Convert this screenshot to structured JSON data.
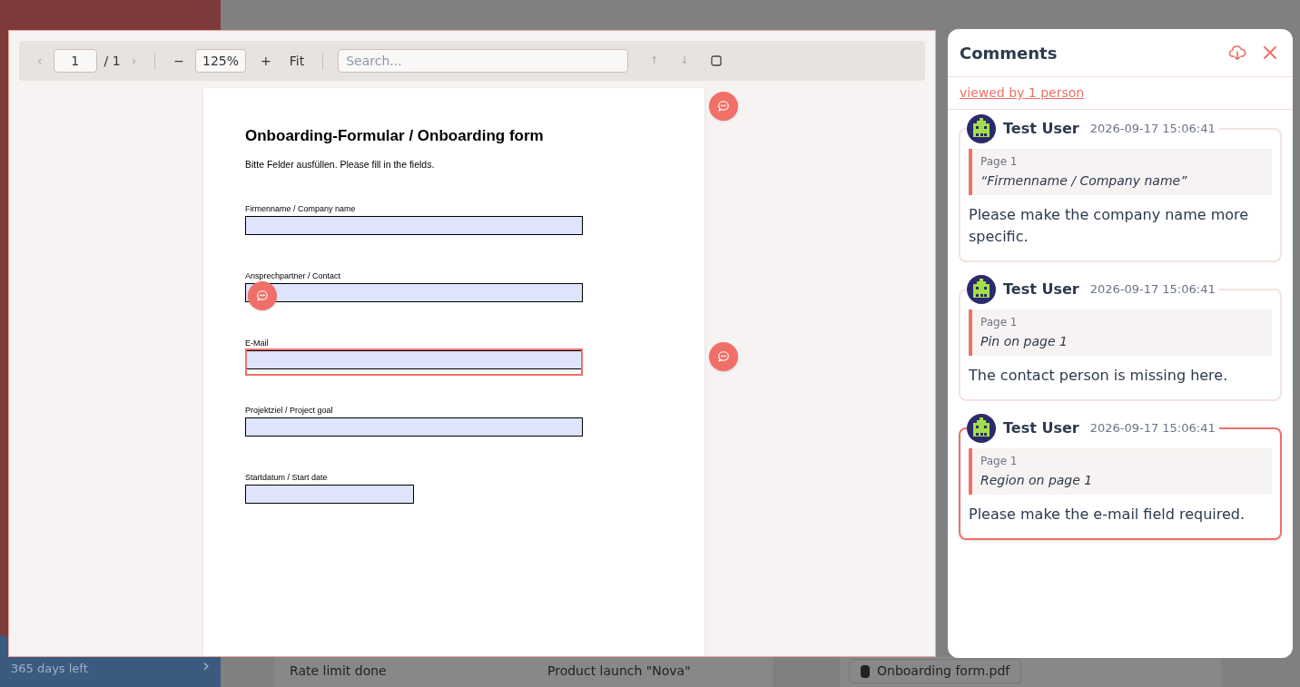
{
  "background": {
    "upgrade": {
      "subtitle": "365 days left",
      "chevron": "›"
    },
    "table_rows": [
      {
        "title": "Rate limit done",
        "project": "Product launch \"Nova\""
      }
    ],
    "attachment": "Onboarding form.pdf"
  },
  "viewer": {
    "toolbar": {
      "prev": "‹",
      "page": "1",
      "total": "/ 1",
      "next": "›",
      "zoom_out": "−",
      "zoom": "125%",
      "zoom_in": "+",
      "fit": "Fit",
      "search_placeholder": "Search...",
      "find_prev": "↑",
      "find_next": "↓"
    },
    "document": {
      "title": "Onboarding-Formular / Onboarding form",
      "subtitle": "Bitte Felder ausfüllen. Please fill in the fields.",
      "top_pin": true,
      "fields": [
        {
          "label": "Firmenname / Company name",
          "kind": "wide",
          "pin": false,
          "region": false
        },
        {
          "label": "Ansprechpartner / Contact",
          "kind": "wide",
          "pin": true,
          "region": false
        },
        {
          "label": "E-Mail",
          "kind": "wide",
          "pin": false,
          "region": true
        },
        {
          "label": "Projektziel / Project goal",
          "kind": "wide",
          "pin": false,
          "region": false
        },
        {
          "label": "Startdatum / Start date",
          "kind": "short",
          "pin": false,
          "region": false
        }
      ]
    }
  },
  "comments_panel": {
    "title": "Comments",
    "viewed_link": "viewed by 1 person",
    "comments": [
      {
        "author": "Test User",
        "time": "2026-09-17 15:06:41",
        "page": "Page 1",
        "quote": "“Firmenname / Company name”",
        "body": "Please make the company name more specific.",
        "selected": false
      },
      {
        "author": "Test User",
        "time": "2026-09-17 15:06:41",
        "page": "Page 1",
        "quote": "Pin on page 1",
        "body": "The contact person is missing here.",
        "selected": false
      },
      {
        "author": "Test User",
        "time": "2026-09-17 15:06:41",
        "page": "Page 1",
        "quote": "Region on page 1",
        "body": "Please make the e-mail field required.",
        "selected": true
      }
    ]
  }
}
